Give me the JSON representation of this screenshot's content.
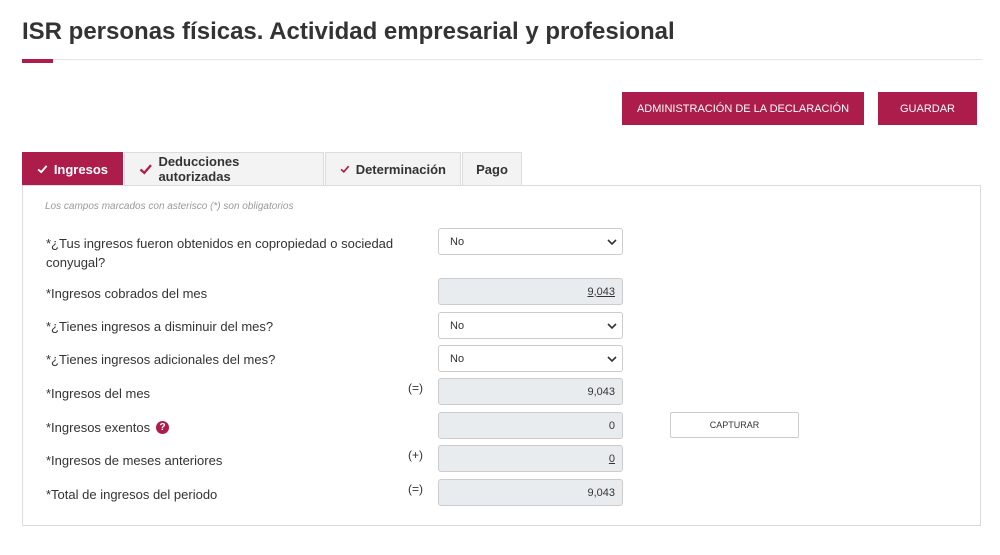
{
  "page": {
    "title": "ISR personas físicas. Actividad empresarial y profesional"
  },
  "actions": {
    "admin_label": "ADMINISTRACIÓN DE LA DECLARACIÓN",
    "save_label": "GUARDAR"
  },
  "tabs": [
    {
      "label": "Ingresos",
      "checked": true,
      "active": true
    },
    {
      "label": "Deducciones autorizadas",
      "checked": true,
      "active": false
    },
    {
      "label": "Determinación",
      "checked": true,
      "active": false
    },
    {
      "label": "Pago",
      "checked": false,
      "active": false
    }
  ],
  "form": {
    "required_note": "Los campos marcados con asterisco (*) son obligatorios",
    "copropiedad": {
      "label_line1": "*¿Tus ingresos fueron obtenidos en copropiedad o sociedad",
      "label_line2": "conyugal?",
      "value": "No"
    },
    "ingresos_cobrados": {
      "label": "*Ingresos cobrados del mes",
      "value": "9,043"
    },
    "ingresos_disminuir": {
      "label": "*¿Tienes ingresos a disminuir del mes?",
      "value": "No"
    },
    "ingresos_adicionales": {
      "label": "*¿Tienes ingresos adicionales del mes?",
      "value": "No"
    },
    "ingresos_mes": {
      "label": "*Ingresos del mes",
      "operator": "(=)",
      "value": "9,043"
    },
    "ingresos_exentos": {
      "label": "*Ingresos exentos",
      "help": "?",
      "value": "0",
      "capture_label": "CAPTURAR"
    },
    "meses_anteriores": {
      "label": "*Ingresos de meses anteriores",
      "operator": "(+)",
      "value": "0"
    },
    "total_periodo": {
      "label": "*Total de ingresos del periodo",
      "operator": "(=)",
      "value": "9,043"
    }
  },
  "colors": {
    "accent": "#ad1d4c",
    "readonly_bg": "#e9ecef"
  }
}
